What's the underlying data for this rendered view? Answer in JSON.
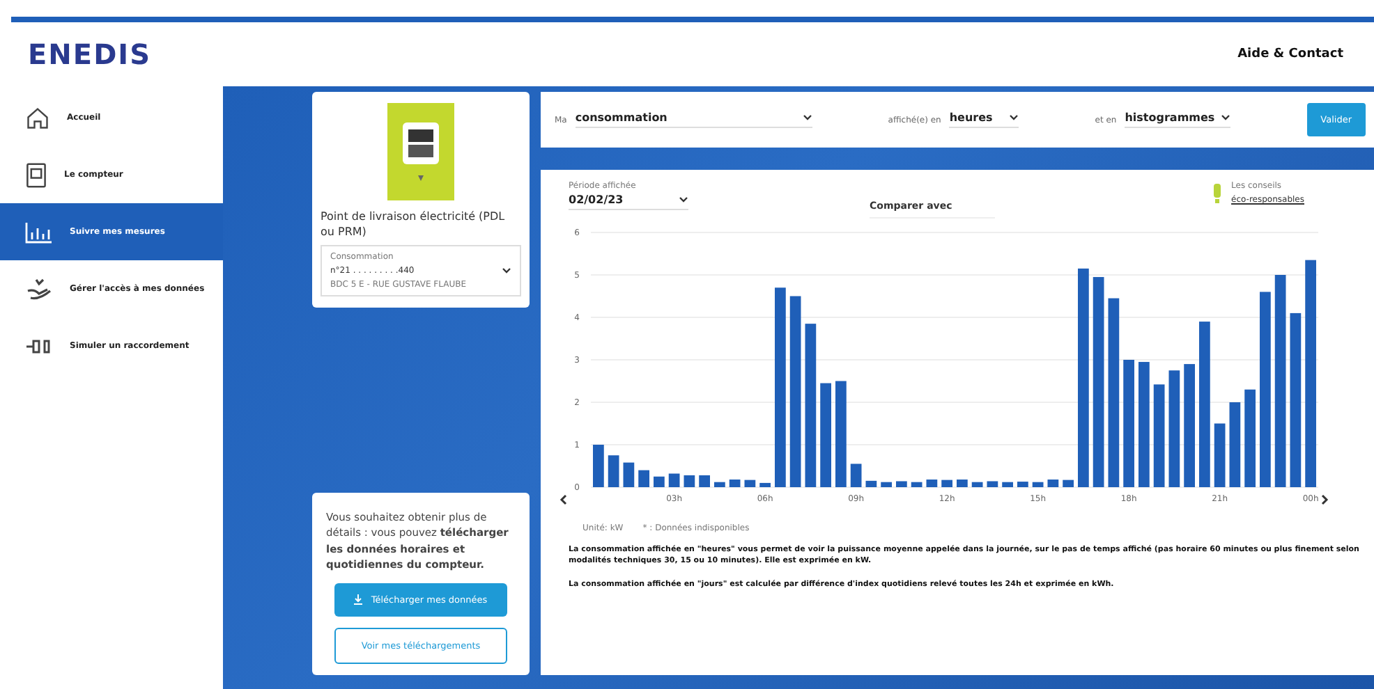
{
  "header": {
    "logo": "ENEDIS",
    "help_link": "Aide & Contact"
  },
  "sidebar": {
    "items": [
      {
        "label": "Accueil",
        "selected": false
      },
      {
        "label": "Le compteur",
        "selected": false
      },
      {
        "label": "Suivre mes mesures",
        "selected": true
      },
      {
        "label": "Gérer l'accès à mes données",
        "selected": false
      },
      {
        "label": "Simuler un raccordement",
        "selected": false
      }
    ]
  },
  "delivery_point": {
    "title": "Point de livraison électricité (PDL ou PRM)",
    "select_label": "Consommation",
    "select_value": "n°21 . . . . . . . . .440",
    "address": "BDC 5 E -    RUE GUSTAVE FLAUBE"
  },
  "download_card": {
    "text": "Vous souhaitez obtenir plus de détails : vous pouvez **télécharger les données horaires et quotidiennes du compteur.**",
    "primary_button": "Télécharger mes données",
    "secondary_button": "Voir mes téléchargements"
  },
  "filters": {
    "prefix": "Ma",
    "measure": "consommation",
    "unit_label": "affiché(e) en",
    "unit": "heures",
    "type_label": "et en",
    "type": "histogrammes",
    "submit": "Valider"
  },
  "chart_panel": {
    "period_label": "Période affichée",
    "period": "02/02/23",
    "compare": "Comparer avec",
    "tips_title": "Les conseils",
    "tips_link": "éco-responsables",
    "chart_data": {
      "type": "bar",
      "categories": [
        null,
        null,
        null,
        null,
        null,
        "03h",
        null,
        null,
        null,
        null,
        null,
        "06h",
        null,
        null,
        null,
        null,
        null,
        "09h",
        null,
        null,
        null,
        null,
        null,
        "12h",
        null,
        null,
        null,
        null,
        null,
        "15h",
        null,
        null,
        null,
        null,
        null,
        "18h",
        null,
        null,
        null,
        null,
        null,
        "21h",
        null,
        null,
        null,
        null,
        null,
        "00h"
      ],
      "series": [
        {
          "color": "#1f5fb8",
          "values": [
            1.0,
            0.75,
            0.58,
            0.4,
            0.25,
            0.32,
            0.28,
            0.28,
            0.12,
            0.18,
            0.17,
            0.1,
            4.7,
            4.5,
            3.85,
            2.45,
            2.5,
            0.55,
            0.15,
            0.12,
            0.14,
            0.12,
            0.18,
            0.17,
            0.18,
            0.12,
            0.14,
            0.12,
            0.13,
            0.12,
            0.18,
            0.17,
            5.15,
            4.95,
            4.45,
            3.0,
            2.95,
            2.42,
            2.75,
            2.9,
            3.9,
            1.5,
            2.0,
            2.3,
            4.6,
            5.0,
            4.1,
            5.35
          ]
        }
      ],
      "ylim": [
        0,
        6
      ],
      "yticks": [
        0,
        1,
        2,
        3,
        4,
        5,
        6
      ],
      "grid": true
    },
    "unit_note": "Unité: kW",
    "legend_note": "* : Données indisponibles",
    "notes": [
      "**La consommation affichée en \"heures\" vous permet de voir la puissance moyenne appelée dans la journée, sur le pas de temps affiché (pas horaire 60 minutes ou plus finement selon modalités techniques 30, 15 ou 10 minutes). Elle est exprimée en kW.**",
      "**La consommation affichée en \"jours\" est calculée par différence d'index quotidiens relevé toutes les 24h et exprimée en kWh.**"
    ]
  }
}
